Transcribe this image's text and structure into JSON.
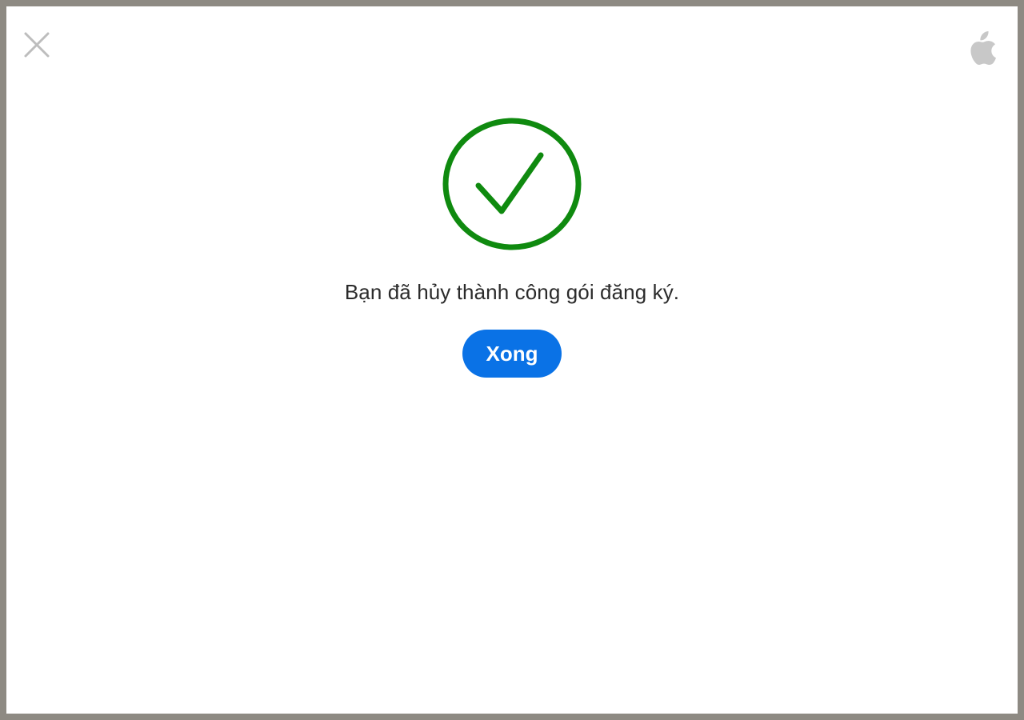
{
  "header": {
    "close_icon": "close-icon",
    "logo_icon": "apple-logo-icon"
  },
  "status": {
    "icon": "check-circle-icon",
    "message": "Bạn đã hủy thành công gói đăng ký."
  },
  "actions": {
    "done_label": "Xong"
  },
  "colors": {
    "success_green": "#0f8a0f",
    "accent_blue": "#0a72e6",
    "icon_gray": "#c8c8c8",
    "text": "#2b2b2b"
  }
}
